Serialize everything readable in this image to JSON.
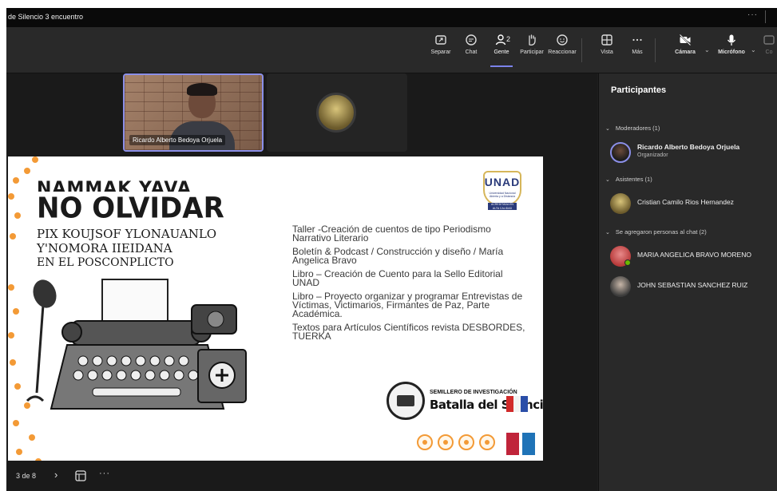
{
  "window": {
    "title": "de Silencio 3 encuentro",
    "more": "···"
  },
  "toolbar": {
    "items": [
      {
        "label": "Separar",
        "icon": "pop-out-icon"
      },
      {
        "label": "Chat",
        "icon": "chat-icon"
      },
      {
        "label": "Gente",
        "icon": "people-icon",
        "badge": "2"
      },
      {
        "label": "Participar",
        "icon": "raise-hand-icon"
      },
      {
        "label": "Reaccionar",
        "icon": "smiley-icon"
      },
      {
        "label": "Vista",
        "icon": "grid-view-icon"
      },
      {
        "label": "Más",
        "icon": "more-icon"
      },
      {
        "label": "Cámara",
        "icon": "camera-off-icon"
      },
      {
        "label": "Micrófono",
        "icon": "microphone-icon"
      },
      {
        "label": "Co",
        "icon": "share-icon"
      }
    ],
    "active": "Gente",
    "more_glyph": "···"
  },
  "stage": {
    "video_name": "Ricardo Alberto Bedoya Orjuela"
  },
  "slide": {
    "poster_lines": [
      "NAMMAK YAVA",
      "NO OLVIDAR",
      "PIX KOUJSOF YLONAUANLO",
      "Y'NOMORA IIEIDANA",
      "EN EL POSCONPLICTO"
    ],
    "unad_logo": {
      "name": "UNAD",
      "subtitle": "Universidad Nacional Abierta y a Distancia",
      "accreditation": "ACREDITADA EN ALTA CALIDAD"
    },
    "items": [
      "Taller -Creación de cuentos de tipo Periodismo Narrativo Literario",
      "Boletín & Podcast / Construcción y diseño / María Angelica Bravo",
      "Libro – Creación de Cuento para la Sello Editorial UNAD",
      "Libro – Proyecto organizar y programar Entrevistas de Víctimas, Victimarios, Firmantes de Paz, Parte Académica.",
      "Textos para Artículos Científicos revista DESBORDES, TUERKA"
    ],
    "semillero_line1": "SEMILLERO DE INVESTIGACIÓN",
    "semillero_line2": "Batalla del Silencio"
  },
  "bottombar": {
    "page": "3 de 8",
    "arrow": "›",
    "more": "···"
  },
  "panel": {
    "title": "Participantes",
    "sections": {
      "moderators": "Moderadores (1)",
      "attendees": "Asistentes (1)",
      "chat": "Se agregaron personas al chat (2)"
    },
    "moderator": {
      "name": "Ricardo Alberto Bedoya Orjuela",
      "role": "Organizador"
    },
    "attendee": {
      "name": "Cristian Camilo Rios Hernandez"
    },
    "chat_people": [
      {
        "name": "MARIA ANGELICA BRAVO MORENO"
      },
      {
        "name": "JOHN SEBASTIAN SANCHEZ RUIZ"
      }
    ]
  },
  "colors": {
    "accent": "#7b83eb",
    "slide_dots": "#f39a36",
    "online": "#6bb700",
    "toolbar_bg": "#292929",
    "stage_bg": "#1a1a1a"
  }
}
